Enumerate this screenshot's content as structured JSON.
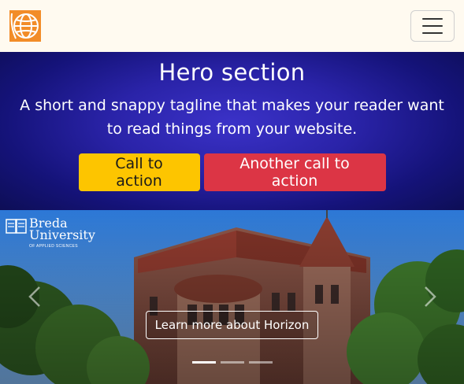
{
  "navbar": {
    "logo_icon": "globe-logo-icon",
    "toggler_icon": "hamburger-menu-icon",
    "background": "#fffaf0",
    "logo_color": "#f28c28"
  },
  "hero": {
    "title": "Hero section",
    "tagline": "A short and snappy tagline that makes your reader want to read things from your website.",
    "primary_cta": "Call to action",
    "secondary_cta": "Another call to action",
    "colors": {
      "primary_cta": "#fdc500",
      "secondary_cta": "#dc3545",
      "background": "#2a23a8"
    }
  },
  "carousel": {
    "image_logo": {
      "line1": "Breda",
      "line2": "University",
      "line3": "OF APPLIED SCIENCES"
    },
    "caption_button": "Learn more about Horizon",
    "indicators": [
      {
        "active": true
      },
      {
        "active": false
      },
      {
        "active": false
      }
    ],
    "prev_icon": "chevron-left-icon",
    "next_icon": "chevron-right-icon"
  }
}
